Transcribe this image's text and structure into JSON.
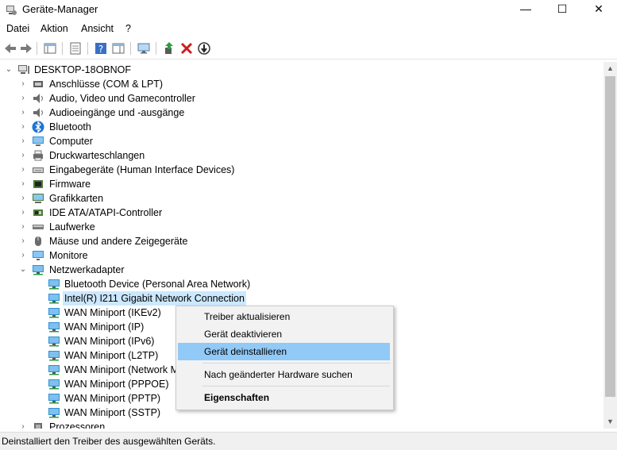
{
  "window": {
    "title": "Geräte-Manager",
    "controls": {
      "minimize": "—",
      "maximize": "☐",
      "close": "✕"
    }
  },
  "menu": [
    "Datei",
    "Aktion",
    "Ansicht",
    "?"
  ],
  "tree": {
    "root": "DESKTOP-18OBNOF",
    "categories": [
      {
        "label": "Anschlüsse (COM & LPT)",
        "icon": "port-icon"
      },
      {
        "label": "Audio, Video und Gamecontroller",
        "icon": "speaker-icon"
      },
      {
        "label": "Audioeingänge und -ausgänge",
        "icon": "speaker-icon"
      },
      {
        "label": "Bluetooth",
        "icon": "bluetooth-icon"
      },
      {
        "label": "Computer",
        "icon": "computer-icon"
      },
      {
        "label": "Druckwarteschlangen",
        "icon": "printer-icon"
      },
      {
        "label": "Eingabegeräte (Human Interface Devices)",
        "icon": "keyboard-icon"
      },
      {
        "label": "Firmware",
        "icon": "chip-icon"
      },
      {
        "label": "Grafikkarten",
        "icon": "display-adapter-icon"
      },
      {
        "label": "IDE ATA/ATAPI-Controller",
        "icon": "controller-icon"
      },
      {
        "label": "Laufwerke",
        "icon": "drive-icon"
      },
      {
        "label": "Mäuse und andere Zeigegeräte",
        "icon": "mouse-icon"
      },
      {
        "label": "Monitore",
        "icon": "monitor-icon"
      },
      {
        "label": "Netzwerkadapter",
        "icon": "network-icon"
      }
    ],
    "network_adapters": [
      "Bluetooth Device (Personal Area Network)",
      "Intel(R) I211 Gigabit Network Connection",
      "WAN Miniport (IKEv2)",
      "WAN Miniport (IP)",
      "WAN Miniport (IPv6)",
      "WAN Miniport (L2TP)",
      "WAN Miniport (Network M",
      "WAN Miniport (PPPOE)",
      "WAN Miniport (PPTP)",
      "WAN Miniport (SSTP)"
    ],
    "partial_next": "Prozessoren"
  },
  "context_menu": {
    "items": [
      "Treiber aktualisieren",
      "Gerät deaktivieren",
      "Gerät deinstallieren",
      "Nach geänderter Hardware suchen",
      "Eigenschaften"
    ],
    "highlighted": "Gerät deinstallieren"
  },
  "status": "Deinstalliert den Treiber des ausgewählten Geräts.",
  "colors": {
    "selection": "#cce8ff",
    "menu_highlight": "#91c9f7",
    "network_icon": "#2f8fd6"
  }
}
